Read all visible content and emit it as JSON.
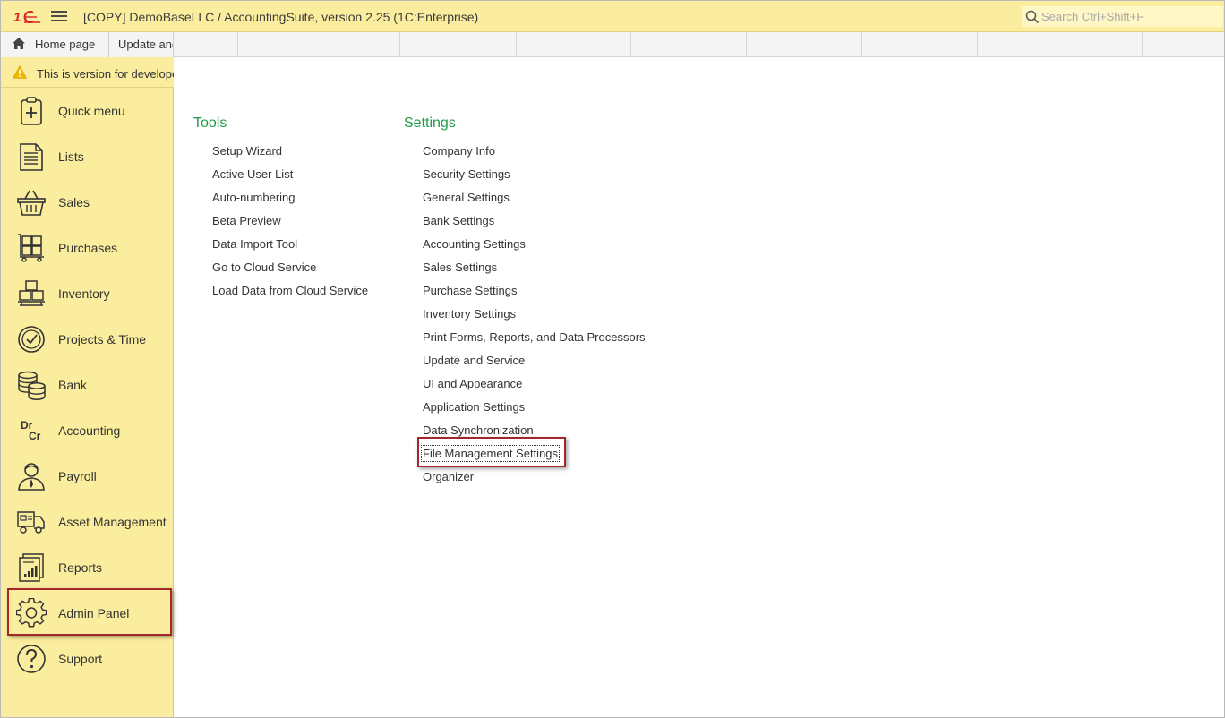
{
  "titlebar": {
    "logo": "1C",
    "title": "[COPY] DemoBaseLLC / AccountingSuite, version 2.25  (1C:Enterprise)",
    "search_placeholder": "Search Ctrl+Shift+F"
  },
  "tabs": [
    {
      "label": "Home page",
      "icon": "home-icon"
    },
    {
      "label": "Update and"
    }
  ],
  "warning": {
    "icon": "warning-icon",
    "text": "This is version for developers"
  },
  "sidebar": {
    "items": [
      {
        "label": "Quick menu",
        "icon": "quick-menu-icon"
      },
      {
        "label": "Lists",
        "icon": "lists-icon"
      },
      {
        "label": "Sales",
        "icon": "basket-icon"
      },
      {
        "label": "Purchases",
        "icon": "cart-boxes-icon"
      },
      {
        "label": "Inventory",
        "icon": "boxes-icon"
      },
      {
        "label": "Projects & Time",
        "icon": "clock-icon"
      },
      {
        "label": "Bank",
        "icon": "coins-icon"
      },
      {
        "label": "Accounting",
        "icon": "dr-cr-icon"
      },
      {
        "label": "Payroll",
        "icon": "person-icon"
      },
      {
        "label": "Asset Management",
        "icon": "truck-icon"
      },
      {
        "label": "Reports",
        "icon": "report-chart-icon"
      },
      {
        "label": "Admin Panel",
        "icon": "gear-icon"
      },
      {
        "label": "Support",
        "icon": "help-icon"
      }
    ],
    "active_item": "Admin Panel"
  },
  "main": {
    "tools": {
      "title": "Tools",
      "links": [
        "Setup Wizard",
        "Active User List",
        "Auto-numbering",
        "Beta Preview",
        "Data Import Tool",
        "Go to Cloud Service",
        "Load Data from Cloud Service"
      ]
    },
    "settings": {
      "title": "Settings",
      "links": [
        "Company Info",
        "Security Settings",
        "General Settings",
        "Bank Settings",
        "Accounting Settings",
        "Sales Settings",
        "Purchase Settings",
        "Inventory Settings",
        "Print Forms, Reports, and Data Processors",
        "Update and Service",
        "UI and Appearance",
        "Application Settings",
        "Data Synchronization",
        "File Management Settings",
        "Organizer"
      ],
      "highlighted": "File Management Settings"
    }
  },
  "colors": {
    "sidebar_bg": "#fbed9e",
    "section_title": "#1c9a45",
    "highlight_border": "#a3262b",
    "logo_red": "#d8232a"
  }
}
